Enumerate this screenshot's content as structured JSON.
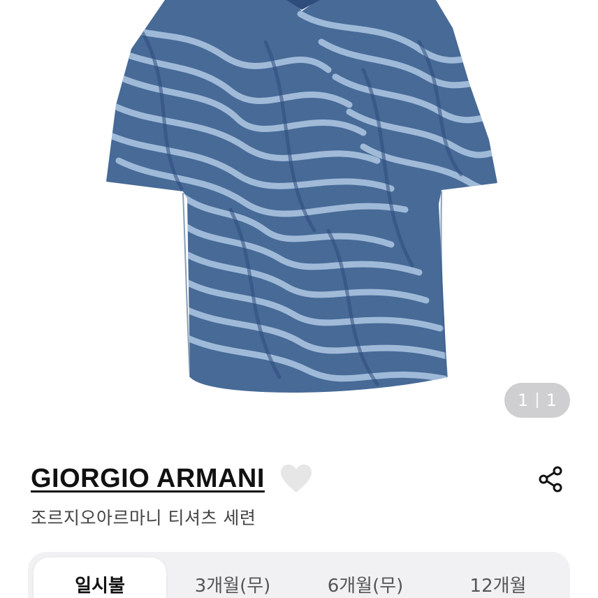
{
  "product_image": {
    "alt": "blue zebra-print short sleeve t-shirt",
    "colors": {
      "fabric_dark": "#476a97",
      "fabric_light": "#a5bfdc",
      "collar": "#2e4c7c"
    }
  },
  "image_counter": {
    "current": "1",
    "total": "1"
  },
  "brand": {
    "name": "GIORGIO ARMANI"
  },
  "icons": {
    "wishlist": "heart-icon",
    "share": "share-icon"
  },
  "product": {
    "title": "조르지오아르마니 티셔츠 세련"
  },
  "payment_tabs": [
    {
      "label": "일시불",
      "active": true
    },
    {
      "label": "3개월(무)",
      "active": false
    },
    {
      "label": "6개월(무)",
      "active": false
    },
    {
      "label": "12개월",
      "active": false
    }
  ],
  "colors": {
    "heart": "#e6e6e6",
    "tab_bar_bg": "#f1f1f3",
    "counter_bg": "#cfcfd1"
  }
}
